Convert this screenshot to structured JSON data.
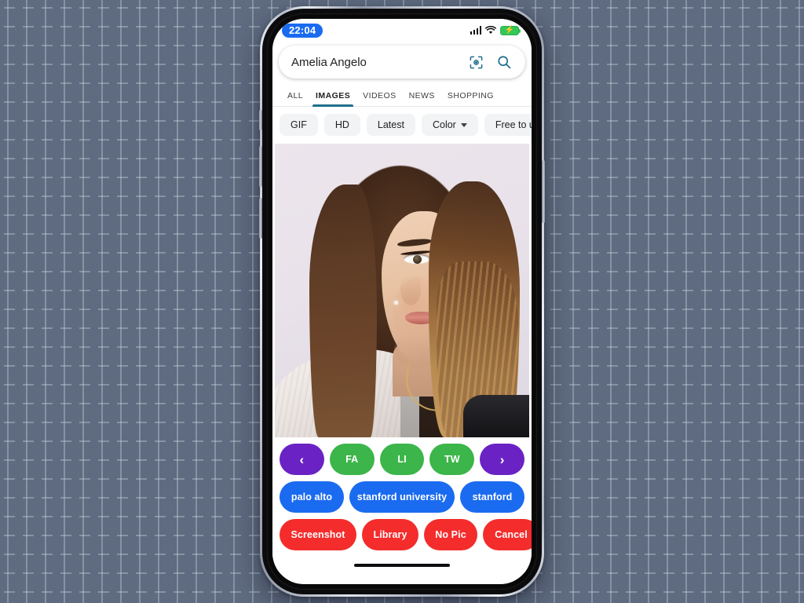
{
  "background": {
    "color": "#5f6b80",
    "pattern": "plus-grid"
  },
  "device": {
    "frame": "iphone-x-silver",
    "buttons": [
      "mute-switch",
      "volume-up",
      "volume-down",
      "power"
    ]
  },
  "status_bar": {
    "time": "22:04",
    "time_badge_color": "#1a6bf0",
    "signal_icon": "cellular-bars-icon",
    "wifi_icon": "wifi-icon",
    "battery_icon": "battery-charging-icon",
    "battery_color": "#34c759",
    "battery_glyph": "⚡"
  },
  "search": {
    "query": "Amelia Angelo",
    "placeholder": "Search",
    "lens_icon": "google-lens-icon",
    "search_icon": "search-icon",
    "icon_color": "#1f6f8b"
  },
  "tabs": [
    {
      "label": "ALL",
      "active": false
    },
    {
      "label": "IMAGES",
      "active": true
    },
    {
      "label": "VIDEOS",
      "active": false
    },
    {
      "label": "NEWS",
      "active": false
    },
    {
      "label": "SHOPPING",
      "active": false
    }
  ],
  "tab_underline_color": "#1f6f8b",
  "filter_chips": [
    {
      "label": "GIF",
      "has_caret": false
    },
    {
      "label": "HD",
      "has_caret": false
    },
    {
      "label": "Latest",
      "has_caret": false
    },
    {
      "label": "Color",
      "has_caret": true
    },
    {
      "label": "Free to use",
      "has_caret": false
    }
  ],
  "photo": {
    "alt": "portrait of young woman with long brown hair in white sweater",
    "background_color": "#e8e1e9"
  },
  "action_pad": {
    "nav_row": [
      {
        "label": "‹",
        "name": "prev-button",
        "color": "#6a22c4"
      },
      {
        "label": "FA",
        "name": "facebook-button",
        "color": "#3cb54a"
      },
      {
        "label": "LI",
        "name": "linkedin-button",
        "color": "#3cb54a"
      },
      {
        "label": "TW",
        "name": "twitter-button",
        "color": "#3cb54a"
      },
      {
        "label": "›",
        "name": "next-button",
        "color": "#6a22c4"
      }
    ],
    "keyword_row": [
      {
        "label": "palo alto",
        "name": "keyword-palo-alto",
        "color": "#1a6bf0"
      },
      {
        "label": "stanford university",
        "name": "keyword-stanford-university",
        "color": "#1a6bf0"
      },
      {
        "label": "stanford",
        "name": "keyword-stanford",
        "color": "#1a6bf0"
      }
    ],
    "command_row": [
      {
        "label": "Screenshot",
        "name": "screenshot-button",
        "color": "#f42c2c"
      },
      {
        "label": "Library",
        "name": "library-button",
        "color": "#f42c2c"
      },
      {
        "label": "No Pic",
        "name": "no-pic-button",
        "color": "#f42c2c"
      },
      {
        "label": "Cancel",
        "name": "cancel-button",
        "color": "#f42c2c"
      }
    ]
  }
}
